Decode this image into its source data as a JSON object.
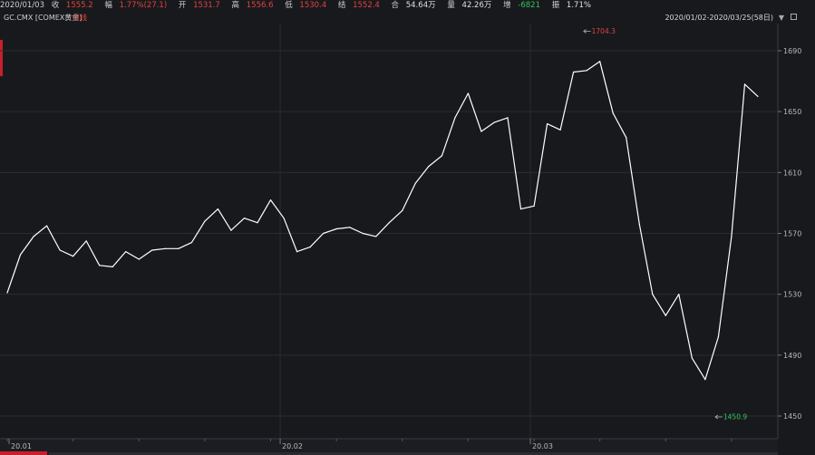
{
  "topbar": {
    "date": "2020/01/03",
    "close_label": "收",
    "close_value": "1555.2",
    "change_label": "幅",
    "change_value": "1.77%(27.1)",
    "open_label": "开",
    "open_value": "1531.7",
    "high_label": "高",
    "high_value": "1556.6",
    "low_label": "低",
    "low_value": "1530.4",
    "settle_label": "结",
    "settle_value": "1552.4",
    "amount_label": "合",
    "amount_value": "54.64万",
    "volume_label": "量",
    "volume_value": "42.26万",
    "oi_change_label": "增",
    "oi_change_value": "-6821",
    "amplitude_label": "振",
    "amplitude_value": "1.71%"
  },
  "subbar": {
    "symbol": "GC.CMX [COMEX黄金]",
    "period": "日线",
    "range": "2020/01/02-2020/03/25(58日)",
    "dropdown_icon": "triangle-down-icon",
    "lock_icon": "square-icon"
  },
  "colors": {
    "background": "#18191d",
    "line": "#ffffff",
    "high_marker": "#e0443e",
    "low_marker": "#33c45a",
    "grid": "#2a2c31"
  },
  "chart_data": {
    "type": "line",
    "title": "",
    "xlabel": "",
    "ylabel": "",
    "x_tick_labels": [
      "20.01",
      "20.02",
      "20.03"
    ],
    "y_ticks": [
      1450,
      1490,
      1530,
      1570,
      1610,
      1650,
      1690
    ],
    "ylim": [
      1440,
      1700
    ],
    "grid": true,
    "y_axis_side": "right",
    "series": [
      {
        "values": [
          1531,
          1556,
          1568,
          1575,
          1559,
          1555,
          1565,
          1549,
          1548,
          1558,
          1553,
          1559,
          1560,
          1560,
          1564,
          1578,
          1586,
          1572,
          1580,
          1577,
          1592,
          1580,
          1558,
          1561,
          1570,
          1573,
          1574,
          1570,
          1568,
          1577,
          1585,
          1603,
          1614,
          1621,
          1646,
          1662,
          1637,
          1643,
          1646,
          1586,
          1588,
          1642,
          1638,
          1676,
          1677,
          1683,
          1649,
          1633,
          1576,
          1530,
          1516,
          1530,
          1488,
          1474,
          1502,
          1568,
          1668,
          1660
        ]
      }
    ],
    "annotations": [
      {
        "label": "1704.3",
        "index": 43,
        "value": 1704.3,
        "kind": "high"
      },
      {
        "label": "1450.9",
        "index": 53,
        "value": 1450.9,
        "kind": "low"
      }
    ]
  }
}
